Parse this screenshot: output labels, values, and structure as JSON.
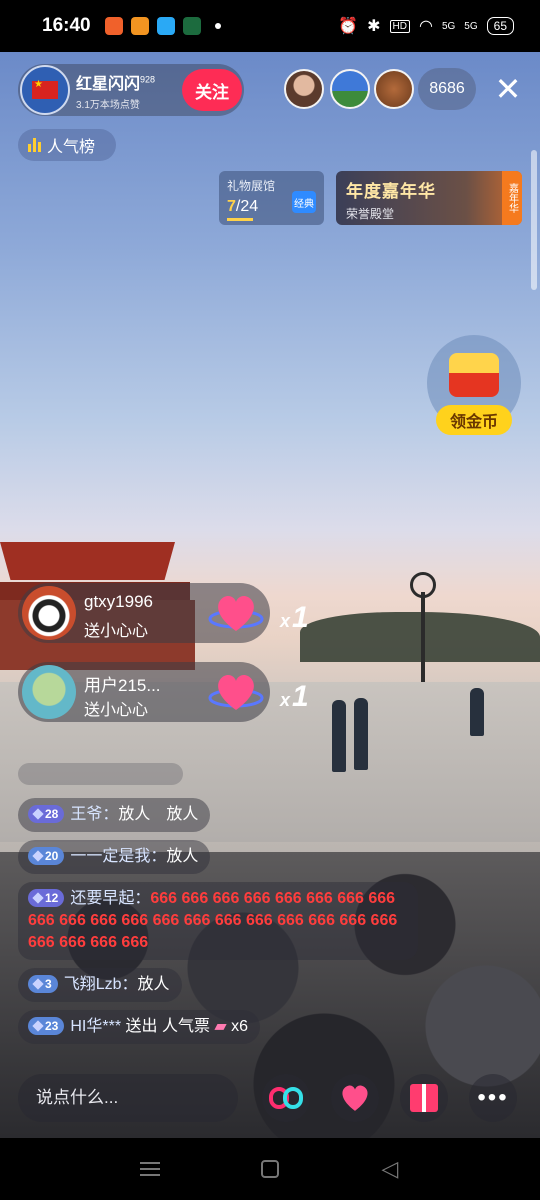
{
  "status_bar": {
    "time": "16:40",
    "battery": "65",
    "hd_label": "HD",
    "signal_1": "5G",
    "signal_2": "5G"
  },
  "host": {
    "name": "红星闪闪",
    "name_sup": "928",
    "subtitle": "3.1万本场点赞",
    "follow_label": "关注"
  },
  "viewers": {
    "count": "8686",
    "close": "✕"
  },
  "rank": {
    "label": "人气榜"
  },
  "gift_hall": {
    "title": "礼物展馆",
    "current": "7",
    "total": "/24",
    "badge": "经典"
  },
  "carnival": {
    "title": "年度嘉年华",
    "subtitle": "荣誉殿堂",
    "tab": "嘉年华"
  },
  "coin_widget": {
    "label": "领金币"
  },
  "gift_events": [
    {
      "user": "gtxy1996",
      "action": "送小心心",
      "mult_x": "x",
      "mult_n": "1"
    },
    {
      "user": "用户215...",
      "action": "送小心心",
      "mult_x": "x",
      "mult_n": "1"
    }
  ],
  "chat": [
    {
      "level": "28",
      "user": "王爷：",
      "text": "放人　放人"
    },
    {
      "level": "20",
      "user": "一一定是我：",
      "text": "放人"
    },
    {
      "level": "12",
      "user": "还要早起：",
      "text": "666 666 666 666 666 666 666 666 666 666 666 666 666 666 666 666 666 666 666 666 666 666 666 666"
    },
    {
      "level": "3",
      "user": "飞翔Lzb：",
      "text": "放人"
    },
    {
      "level": "23",
      "user": "HI华*** ",
      "text": "送出 人气票",
      "suffix": "x6"
    }
  ],
  "bottom": {
    "input_placeholder": "说点什么...",
    "more": "•••"
  },
  "colors": {
    "accent_pink": "#fe2c55",
    "gold": "#ffd21c",
    "level_badge": "#6a6bd8"
  }
}
